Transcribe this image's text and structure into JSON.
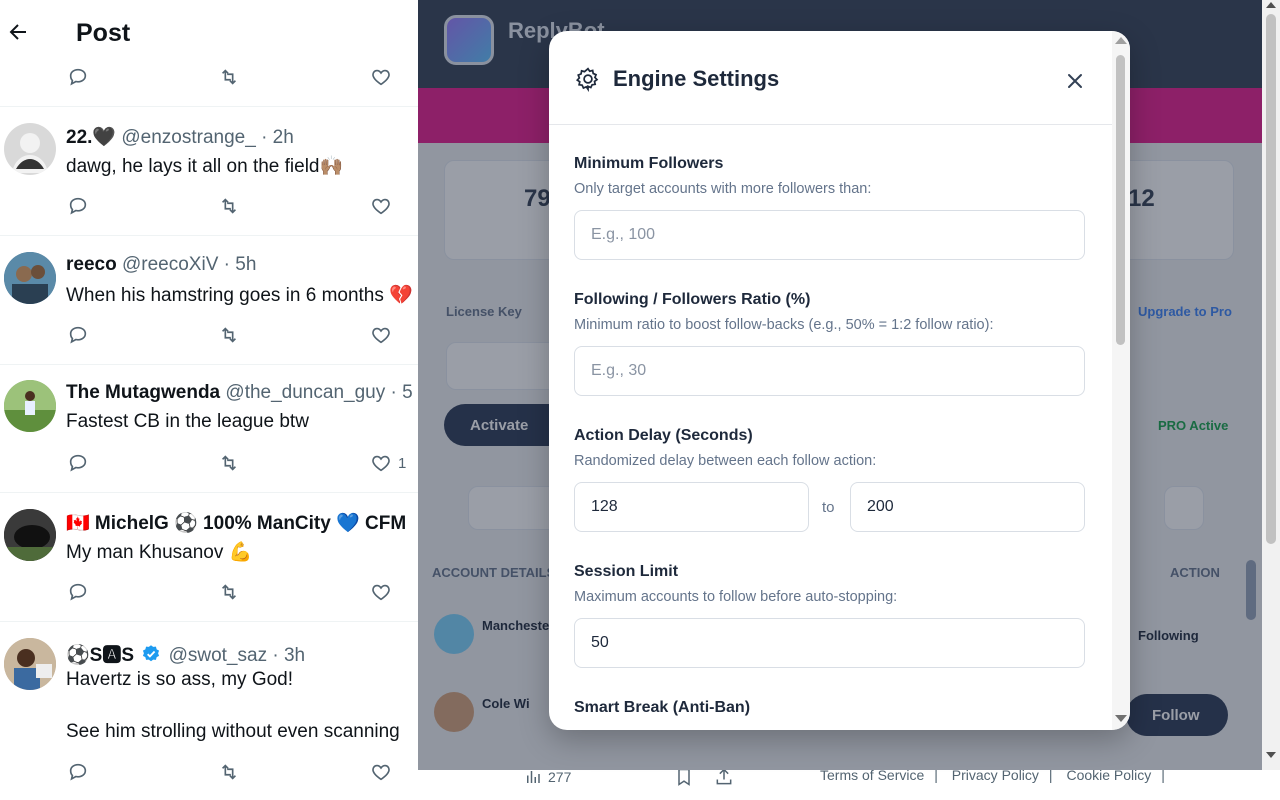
{
  "feed": {
    "title": "Post",
    "tweets": [
      {
        "name": "22.🖤",
        "handle": "@enzostrange_ · 2h",
        "text": "dawg, he lays it all on the field🙌🏽",
        "likes": ""
      },
      {
        "name": "reeco",
        "handle": "@reecoXiV · 5h",
        "text": "When his hamstring goes in 6 months 💔",
        "likes": ""
      },
      {
        "name": "The Mutagwenda",
        "handle": "@the_duncan_guy · 5",
        "text": "Fastest CB in the league btw",
        "likes": "1"
      },
      {
        "name": "🇨🇦 MichelG ⚽ 100% ManCity 💙 CFM",
        "handle": "",
        "text": "My man Khusanov 💪",
        "likes": ""
      },
      {
        "name": "⚽S🅰S",
        "handle": "@swot_saz · 3h",
        "text": "Havertz is so ass, my God!",
        "text2": "See him strolling without even scanning",
        "likes": ""
      }
    ],
    "view_count": "277"
  },
  "footer": {
    "terms": "Terms of Service",
    "privacy": "Privacy Policy",
    "cookie": "Cookie Policy",
    "sep": "|"
  },
  "extension": {
    "brand": "ReplyBot",
    "stat_left": "79",
    "stat_right": "12",
    "pill_activate": "Activate",
    "pill_follow": "Follow",
    "pro_link": "Upgrade to Pro",
    "pro_active": "PRO Active",
    "following": "Following",
    "account_col": "ACCOUNT DETAILS",
    "action_col": "ACTION",
    "license_key": "License Key",
    "row1": "Manchester",
    "row2": "Cole Wi"
  },
  "modal": {
    "title": "Engine Settings",
    "min_followers": {
      "label": "Minimum Followers",
      "help": "Only target accounts with more followers than:",
      "placeholder": "E.g., 100",
      "value": ""
    },
    "ratio": {
      "label": "Following / Followers Ratio (%)",
      "help": "Minimum ratio to boost follow-backs (e.g., 50% = 1:2 follow ratio):",
      "placeholder": "E.g., 30",
      "value": ""
    },
    "delay": {
      "label": "Action Delay (Seconds)",
      "help": "Randomized delay between each follow action:",
      "min": "128",
      "to": "to",
      "max": "200"
    },
    "session": {
      "label": "Session Limit",
      "help": "Maximum accounts to follow before auto-stopping:",
      "value": "50"
    },
    "smart_break": {
      "label": "Smart Break (Anti-Ban)"
    }
  }
}
